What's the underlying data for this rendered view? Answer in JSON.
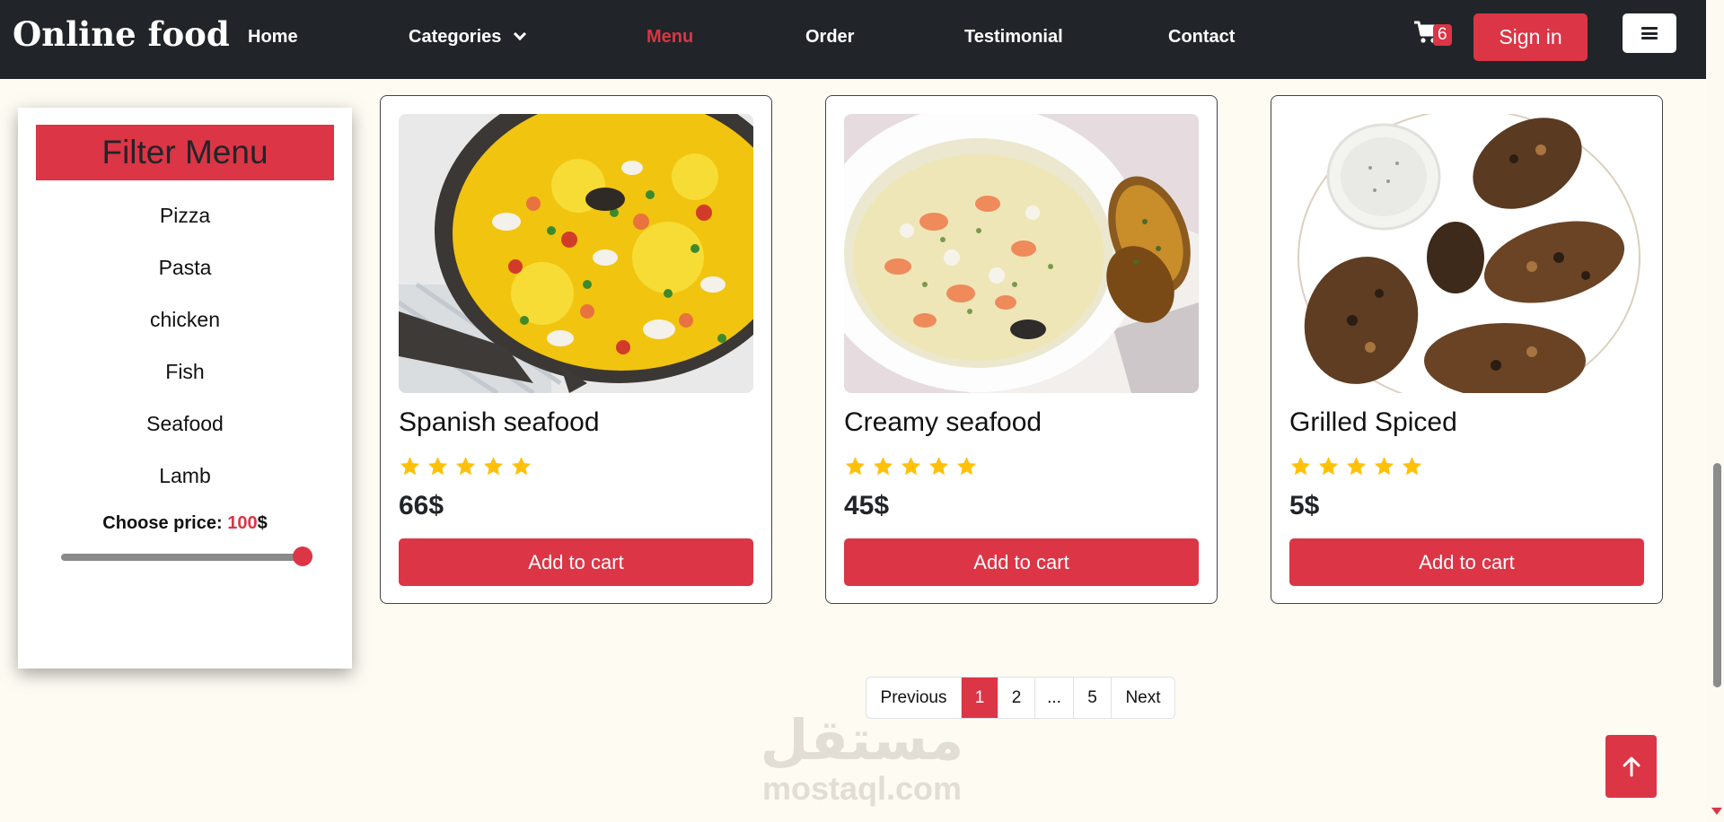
{
  "navbar": {
    "brand": "Online food",
    "links": [
      {
        "label": "Home"
      },
      {
        "label": "Categories"
      },
      {
        "label": "Menu"
      },
      {
        "label": "Order"
      },
      {
        "label": "Testimonial"
      },
      {
        "label": "Contact"
      }
    ],
    "active_link": "Menu",
    "cart_count": "6",
    "signin_label": "Sign in",
    "icons": {
      "cart": "cart-icon",
      "dropdown": "chevron-down-icon",
      "menu": "hamburger-icon"
    }
  },
  "filter": {
    "title": "Filter Menu",
    "items": [
      "Pizza",
      "Pasta",
      "chicken",
      "Fish",
      "Seafood",
      "Lamb"
    ],
    "price_label": "Choose price:",
    "price_value": "100",
    "price_unit": "$",
    "slider_level": 1.0
  },
  "products": [
    {
      "name": "Spanish seafood",
      "rating": 5,
      "price": "66$",
      "button": "Add to cart",
      "image": "paella-pan-photo"
    },
    {
      "name": "Creamy seafood",
      "rating": 5,
      "price": "45$",
      "button": "Add to cart",
      "image": "seafood-chowder-bowl-photo"
    },
    {
      "name": "Grilled Spiced",
      "rating": 5,
      "price": "5$",
      "button": "Add to cart",
      "image": "grilled-chicken-wings-photo"
    }
  ],
  "pagination": {
    "previous": "Previous",
    "pages": [
      "1",
      "2",
      "...",
      "5"
    ],
    "current": "1",
    "next": "Next"
  },
  "watermark": {
    "arabic": "مستقل",
    "latin": "mostaql.com"
  },
  "colors": {
    "accent": "#dc3545",
    "navbar": "#212529",
    "background": "#fefbf3",
    "star": "#ffc107"
  }
}
